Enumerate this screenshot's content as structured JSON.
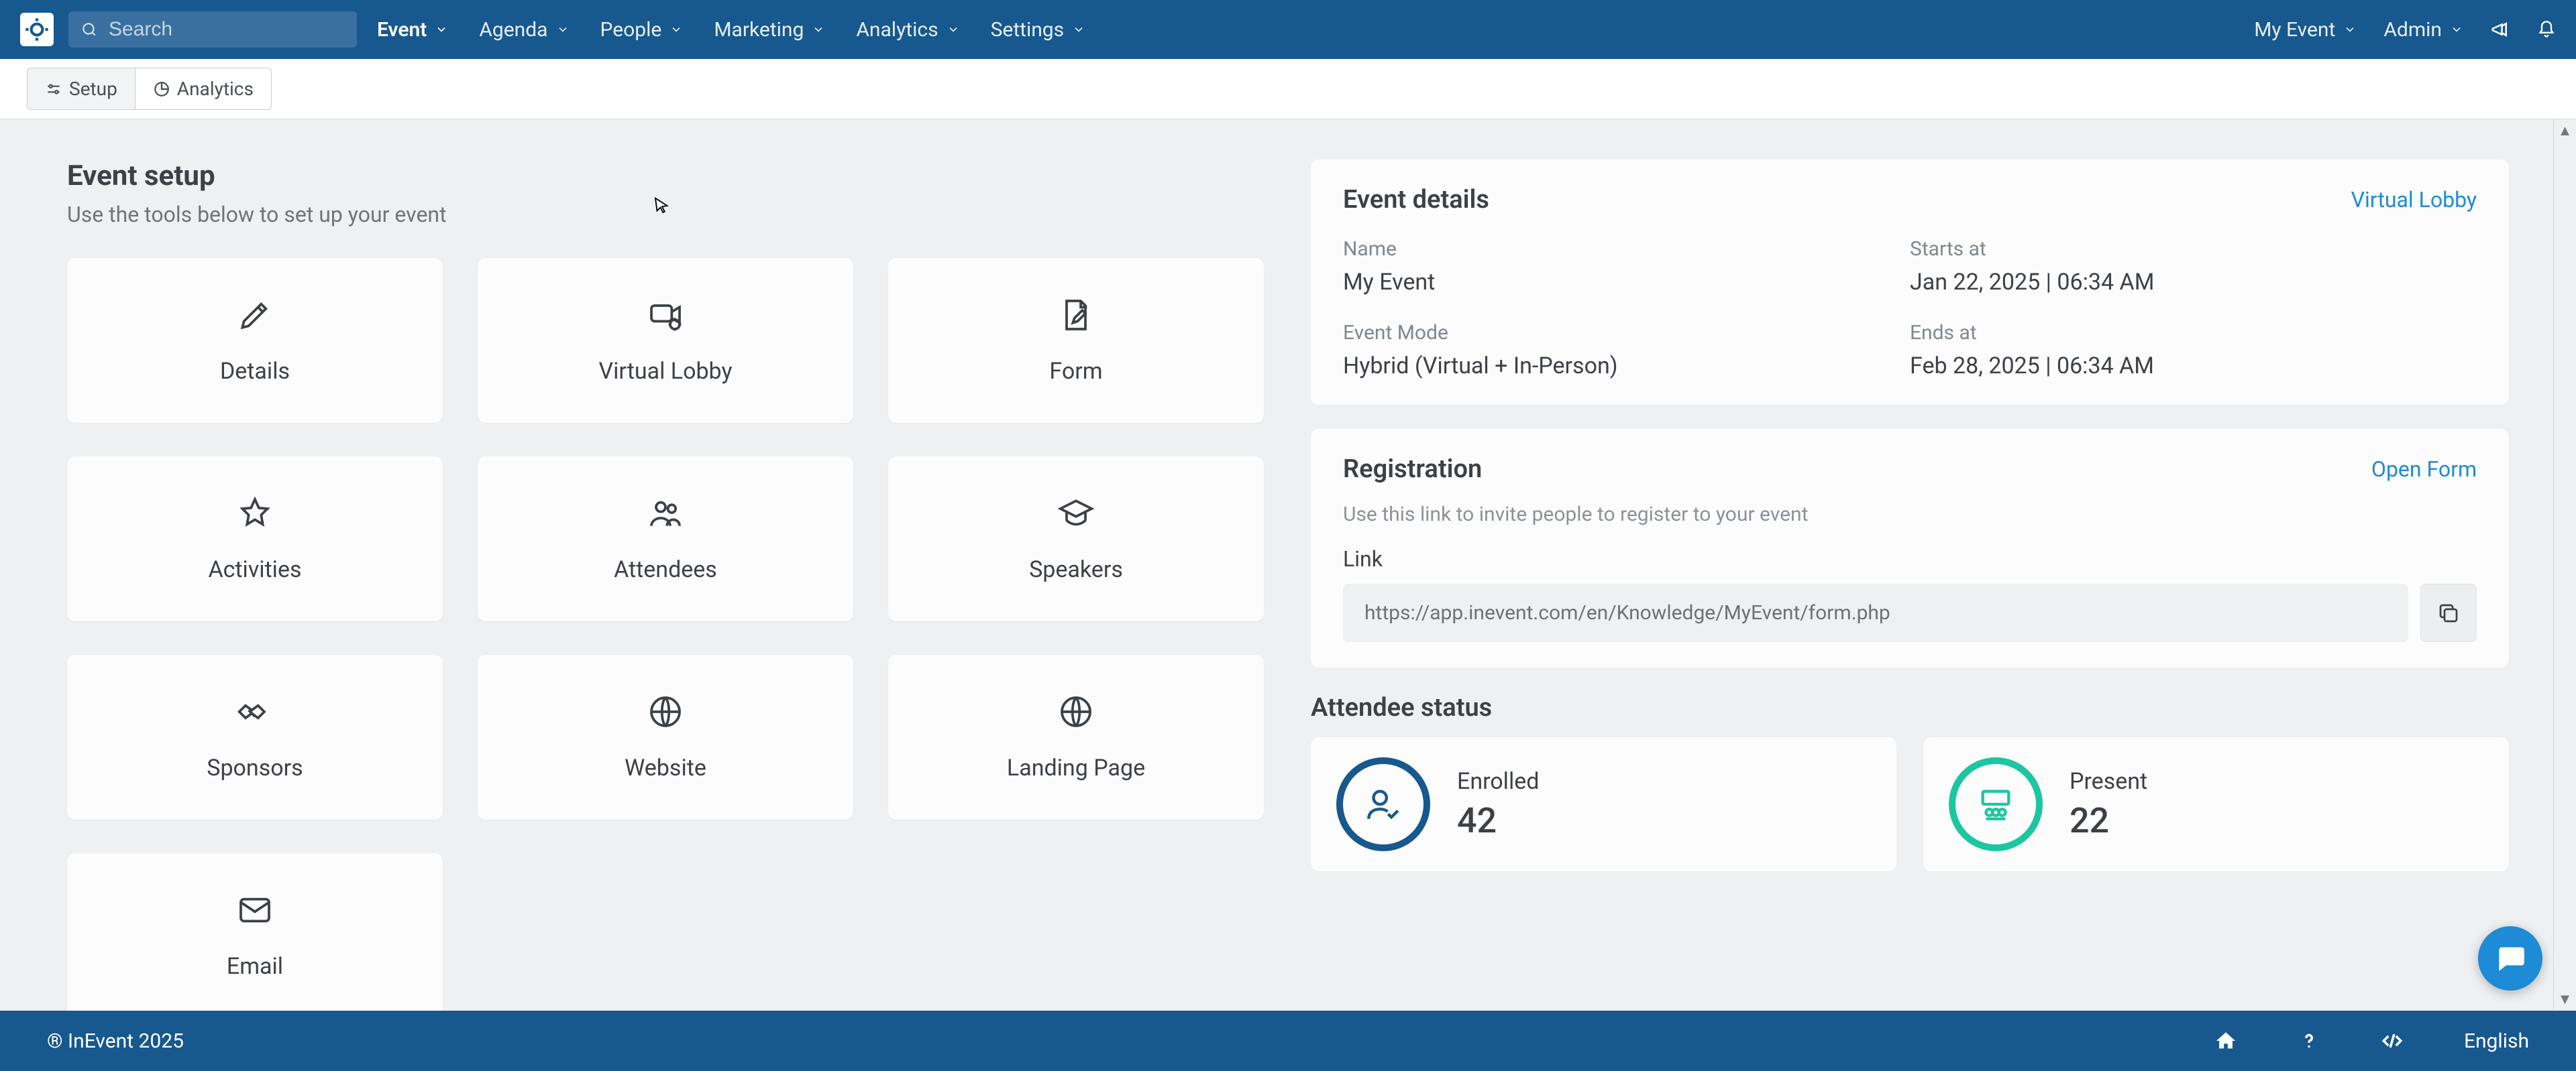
{
  "nav": {
    "search_placeholder": "Search",
    "items": [
      "Event",
      "Agenda",
      "People",
      "Marketing",
      "Analytics",
      "Settings"
    ],
    "active_index": 0,
    "right": {
      "event_switcher": "My Event",
      "user_menu": "Admin"
    }
  },
  "subtabs": {
    "items": [
      "Setup",
      "Analytics"
    ],
    "active_index": 0
  },
  "page": {
    "title": "Event setup",
    "subtitle": "Use the tools below to set up your event"
  },
  "tiles": [
    {
      "id": "details",
      "label": "Details",
      "icon": "pencil-icon"
    },
    {
      "id": "virtual-lobby",
      "label": "Virtual Lobby",
      "icon": "camera-gear-icon"
    },
    {
      "id": "form",
      "label": "Form",
      "icon": "edit-doc-icon"
    },
    {
      "id": "activities",
      "label": "Activities",
      "icon": "star-icon"
    },
    {
      "id": "attendees",
      "label": "Attendees",
      "icon": "people-icon"
    },
    {
      "id": "speakers",
      "label": "Speakers",
      "icon": "grad-cap-icon"
    },
    {
      "id": "sponsors",
      "label": "Sponsors",
      "icon": "handshake-icon"
    },
    {
      "id": "website",
      "label": "Website",
      "icon": "globe-icon"
    },
    {
      "id": "landing-page",
      "label": "Landing Page",
      "icon": "globe-icon"
    },
    {
      "id": "email",
      "label": "Email",
      "icon": "mail-icon"
    }
  ],
  "event_details": {
    "panel_title": "Event details",
    "panel_link": "Virtual Lobby",
    "fields": {
      "name_label": "Name",
      "name_value": "My Event",
      "mode_label": "Event Mode",
      "mode_value": "Hybrid (Virtual + In-Person)",
      "starts_label": "Starts at",
      "starts_value": "Jan 22, 2025 | 06:34 AM",
      "ends_label": "Ends at",
      "ends_value": "Feb 28, 2025 | 06:34 AM"
    }
  },
  "registration": {
    "panel_title": "Registration",
    "panel_link": "Open Form",
    "subtitle": "Use this link to invite people to register to your event",
    "link_label": "Link",
    "link_value": "https://app.inevent.com/en/Knowledge/MyEvent/form.php"
  },
  "attendee_status": {
    "title": "Attendee status",
    "enrolled_label": "Enrolled",
    "enrolled_value": "42",
    "present_label": "Present",
    "present_value": "22"
  },
  "footer": {
    "copyright": "® InEvent 2025",
    "language": "English"
  },
  "colors": {
    "brand": "#17588f",
    "link": "#1e8bd6",
    "teal": "#1cc6a0"
  }
}
